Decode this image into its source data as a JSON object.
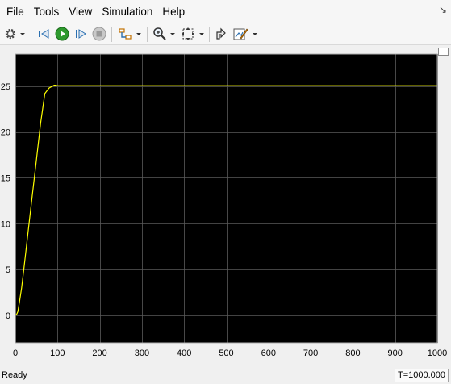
{
  "menu": {
    "items": [
      "File",
      "Tools",
      "View",
      "Simulation",
      "Help"
    ]
  },
  "toolbar": {
    "buttons": [
      {
        "icon": "gear-icon",
        "name": "settings-button"
      },
      {
        "icon": "step-back-icon",
        "name": "step-back-button"
      },
      {
        "icon": "run-icon",
        "name": "run-button"
      },
      {
        "icon": "step-forward-icon",
        "name": "step-forward-button"
      },
      {
        "icon": "stop-icon",
        "name": "stop-button"
      },
      {
        "icon": "signal-highlight-icon",
        "name": "highlight-button"
      },
      {
        "icon": "zoom-icon",
        "name": "zoom-button"
      },
      {
        "icon": "autoscale-icon",
        "name": "autoscale-button"
      },
      {
        "icon": "restore-layout-icon",
        "name": "restore-button"
      },
      {
        "icon": "style-icon",
        "name": "style-button"
      }
    ]
  },
  "chart_data": {
    "type": "line",
    "xlim": [
      0,
      1000
    ],
    "ylim": [
      -3,
      28.5
    ],
    "xticks": [
      0,
      100,
      200,
      300,
      400,
      500,
      600,
      700,
      800,
      900,
      1000
    ],
    "yticks": [
      0,
      5,
      10,
      15,
      20,
      25
    ],
    "grid": true,
    "background": "#000000",
    "line_color": "#ffff00",
    "series": [
      {
        "x": [
          0,
          3,
          6,
          10,
          15,
          20,
          30,
          40,
          50,
          60,
          70,
          80,
          84,
          86,
          88,
          90,
          92,
          95,
          100,
          150,
          200,
          300,
          400,
          500,
          600,
          700,
          800,
          900,
          1000
        ],
        "values": [
          0,
          0.1,
          0.4,
          1.5,
          3.0,
          5.0,
          9.0,
          13.0,
          17.0,
          21.0,
          24.2,
          24.8,
          24.9,
          24.95,
          25.0,
          25.05,
          25.1,
          25.1,
          25.05,
          25.05,
          25.05,
          25.05,
          25.05,
          25.05,
          25.05,
          25.05,
          25.05,
          25.05,
          25.05
        ]
      }
    ]
  },
  "status": {
    "text": "Ready",
    "time": "T=1000.000"
  }
}
